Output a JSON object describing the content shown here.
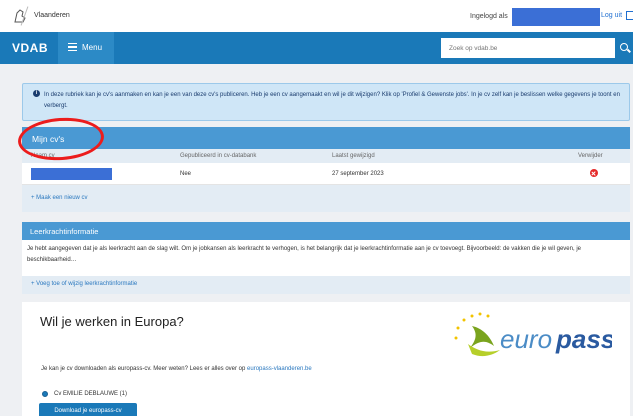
{
  "topbar": {
    "brand": "Vlaanderen",
    "login_label": "Ingelogd als",
    "logout_label": "Log uit"
  },
  "navbar": {
    "logo": "VDAB",
    "menu_label": "Menu",
    "search_placeholder": "Zoek op vdab.be"
  },
  "info": {
    "icon": "info-icon",
    "text": "In deze rubriek kan je cv's aanmaken en kan je een van deze cv's publiceren. Heb je een cv aangemaakt en wil je dit wijzigen? Klik op 'Profiel & Gewenste jobs'. In je cv zelf kan je beslissen welke gegevens je toont en verbergt."
  },
  "cv_panel": {
    "title": "Mijn cv's",
    "columns": [
      "Naam cv",
      "Gepubliceerd in cv-databank",
      "Laatst gewijzigd",
      "Verwijder"
    ],
    "rows": [
      {
        "published": "Nee",
        "modified": "27 september 2023"
      }
    ],
    "add_link": "+ Maak een nieuw cv"
  },
  "teacher_panel": {
    "title": "Leerkrachtinformatie",
    "body": "Je hebt aangegeven dat je als leerkracht aan de slag wilt. Om je jobkansen als leerkracht te verhogen, is het belangrijk dat je leerkrachtinformatie aan je cv toevoegt. Bijvoorbeeld: de vakken die je wil geven, je beschikbaarheid…",
    "add_link": "+ Voeg toe of wijzig leerkrachtinformatie"
  },
  "europass": {
    "title": "Wil je werken in Europa?",
    "logo_text_1": "euro",
    "logo_text_2": "pass",
    "text_before": "Je kan je cv downloaden als europass-cv. Meer weten? Lees er alles over op ",
    "link": "europass-vlaanderen.be",
    "radio_label": "Cv EMILIE DEBLAUWE (1)",
    "download_label": "Download je europass-cv"
  },
  "colors": {
    "nav_blue": "#1a79b8",
    "panel_blue": "#4a99d3",
    "annotation_red": "#ec1c1c",
    "redaction_blue": "#3b6fd6"
  }
}
